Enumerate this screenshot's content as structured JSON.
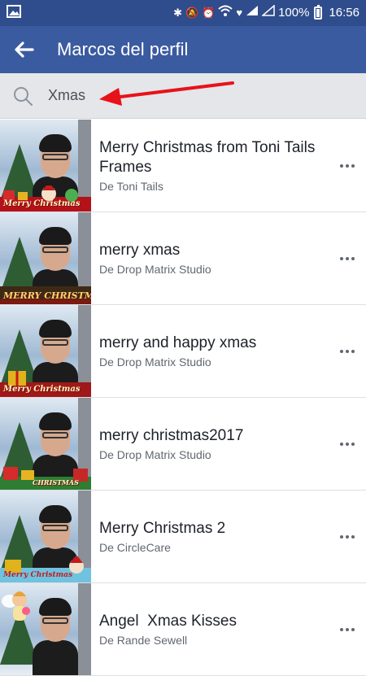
{
  "status_bar": {
    "battery": "100%",
    "time": "16:56"
  },
  "app_bar": {
    "title": "Marcos del perfil"
  },
  "search": {
    "value": "Xmas"
  },
  "frames": [
    {
      "title": "Merry Christmas from Toni Tails Frames",
      "author": "De Toni Tails",
      "frame_text": "Merry Christmas"
    },
    {
      "title": "merry xmas",
      "author": "De Drop Matrix Studio",
      "frame_text": "MERRY CHRISTMAS"
    },
    {
      "title": "merry and happy xmas",
      "author": "De Drop Matrix Studio",
      "frame_text": "Merry Christmas"
    },
    {
      "title": "merry christmas2017",
      "author": "De Drop Matrix Studio",
      "frame_text": "CHRISTMAS"
    },
    {
      "title": "Merry Christmas 2",
      "author": "De CircleCare",
      "frame_text": "Merry Christmas"
    },
    {
      "title": "Angel  Xmas Kisses",
      "author": "De Rande Sewell",
      "frame_text": ""
    }
  ],
  "colors": {
    "app_bar": "#3b5ba0",
    "status_bar": "#2f4d8c",
    "arrow": "#e8121a"
  }
}
